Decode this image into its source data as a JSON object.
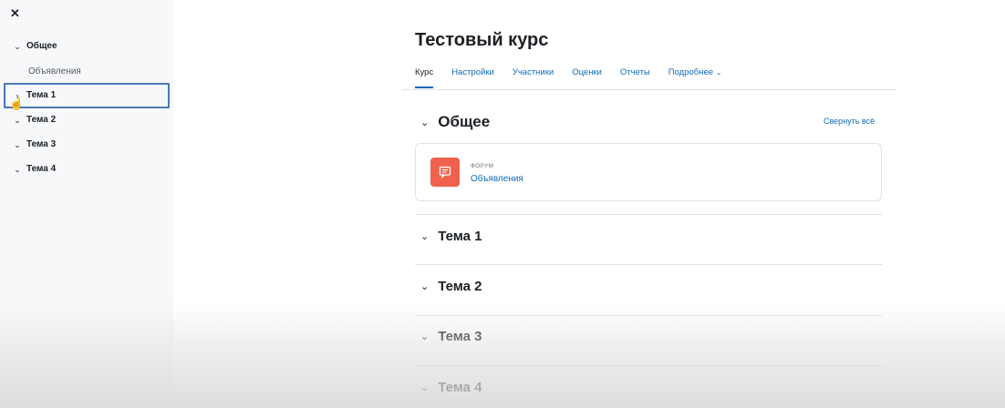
{
  "sidebar": {
    "close_icon": "close-icon",
    "items": [
      {
        "label": "Общее",
        "chevron": "chevron-down-icon",
        "children": [
          {
            "label": "Объявления"
          }
        ]
      },
      {
        "label": "Тема 1",
        "chevron": "chevron-right-icon",
        "selected": true
      },
      {
        "label": "Тема 2",
        "chevron": "chevron-down-icon"
      },
      {
        "label": "Тема 3",
        "chevron": "chevron-down-icon"
      },
      {
        "label": "Тема 4",
        "chevron": "chevron-down-icon"
      }
    ]
  },
  "course": {
    "title": "Тестовый курс",
    "tabs": [
      {
        "label": "Курс",
        "active": true
      },
      {
        "label": "Настройки"
      },
      {
        "label": "Участники"
      },
      {
        "label": "Оценки"
      },
      {
        "label": "Отчеты"
      },
      {
        "label": "Подробнее"
      }
    ],
    "collapse_all": "Свернуть всё",
    "sections": [
      {
        "title": "Общее",
        "activities": [
          {
            "type": "ФОРУМ",
            "name": "Объявления",
            "icon": "forum-icon",
            "color": "#f0624d"
          }
        ]
      },
      {
        "title": "Тема 1"
      },
      {
        "title": "Тема 2"
      },
      {
        "title": "Тема 3"
      },
      {
        "title": "Тема 4"
      }
    ]
  },
  "colors": {
    "link": "#0f6cbf",
    "selection_border": "#4a78b5",
    "forum_icon_bg": "#f0624d"
  }
}
